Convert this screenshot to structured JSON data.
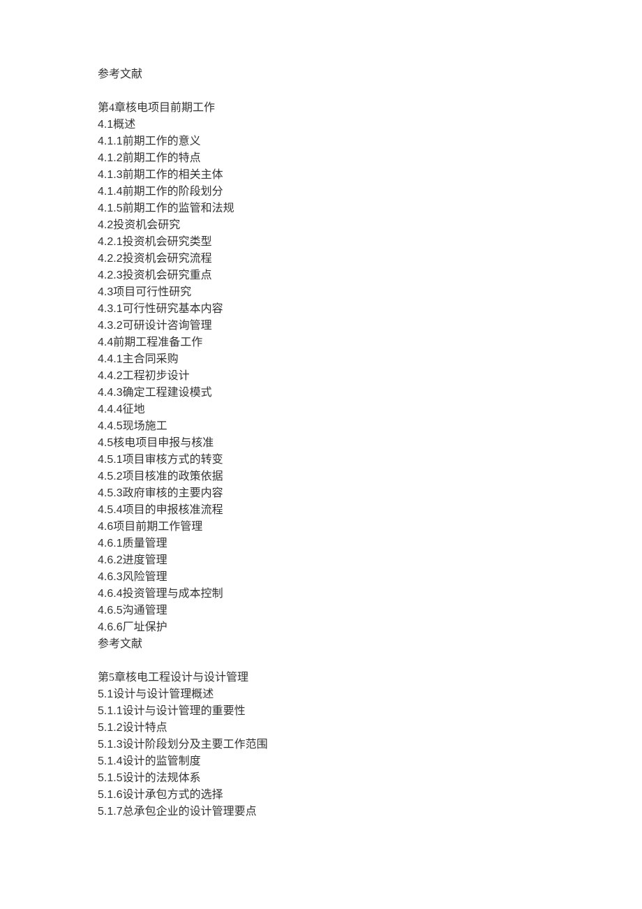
{
  "lines": [
    {
      "prefix": "",
      "text": "参考文献"
    },
    {
      "blank": true
    },
    {
      "prefix": "",
      "text": "第4章核电项目前期工作"
    },
    {
      "prefix": "4.1",
      "text": "概述"
    },
    {
      "prefix": "4.1.1",
      "text": "前期工作的意义"
    },
    {
      "prefix": "4.1.2",
      "text": "前期工作的特点"
    },
    {
      "prefix": "4.1.3",
      "text": "前期工作的相关主体"
    },
    {
      "prefix": "4.1.4",
      "text": "前期工作的阶段划分"
    },
    {
      "prefix": "4.1.5",
      "text": "前期工作的监管和法规"
    },
    {
      "prefix": "4.2",
      "text": "投资机会研究"
    },
    {
      "prefix": "4.2.1",
      "text": "投资机会研究类型"
    },
    {
      "prefix": "4.2.2",
      "text": "投资机会研究流程"
    },
    {
      "prefix": "4.2.3",
      "text": "投资机会研究重点"
    },
    {
      "prefix": "4.3",
      "text": "项目可行性研究"
    },
    {
      "prefix": "4.3.1",
      "text": "可行性研究基本内容"
    },
    {
      "prefix": "4.3.2",
      "text": "可研设计咨询管理"
    },
    {
      "prefix": "4.4",
      "text": "前期工程准备工作"
    },
    {
      "prefix": "4.4.1",
      "text": "主合同采购"
    },
    {
      "prefix": "4.4.2",
      "text": "工程初步设计"
    },
    {
      "prefix": "4.4.3",
      "text": "确定工程建设模式"
    },
    {
      "prefix": "4.4.4",
      "text": "征地"
    },
    {
      "prefix": "4.4.5",
      "text": "现场施工"
    },
    {
      "prefix": "4.5",
      "text": "核电项目申报与核准"
    },
    {
      "prefix": "4.5.1",
      "text": "项目审核方式的转变"
    },
    {
      "prefix": "4.5.2",
      "text": "项目核准的政策依据"
    },
    {
      "prefix": "4.5.3",
      "text": "政府审核的主要内容"
    },
    {
      "prefix": "4.5.4",
      "text": "项目的申报核准流程"
    },
    {
      "prefix": "4.6",
      "text": "项目前期工作管理"
    },
    {
      "prefix": "4.6.1",
      "text": "质量管理"
    },
    {
      "prefix": "4.6.2",
      "text": "进度管理"
    },
    {
      "prefix": "4.6.3",
      "text": "风险管理"
    },
    {
      "prefix": "4.6.4",
      "text": "投资管理与成本控制"
    },
    {
      "prefix": "4.6.5",
      "text": "沟通管理"
    },
    {
      "prefix": "4.6.6",
      "text": "厂址保护"
    },
    {
      "prefix": "",
      "text": "参考文献"
    },
    {
      "blank": true
    },
    {
      "prefix": "",
      "text": "第5章核电工程设计与设计管理"
    },
    {
      "prefix": "5.1",
      "text": "设计与设计管理概述"
    },
    {
      "prefix": "5.1.1",
      "text": "设计与设计管理的重要性"
    },
    {
      "prefix": "5.1.2",
      "text": "设计特点"
    },
    {
      "prefix": "5.1.3",
      "text": "设计阶段划分及主要工作范围"
    },
    {
      "prefix": "5.1.4",
      "text": "设计的监管制度"
    },
    {
      "prefix": "5.1.5",
      "text": "设计的法规体系"
    },
    {
      "prefix": "5.1.6",
      "text": "设计承包方式的选择"
    },
    {
      "prefix": "5.1.7",
      "text": "总承包企业的设计管理要点"
    }
  ]
}
